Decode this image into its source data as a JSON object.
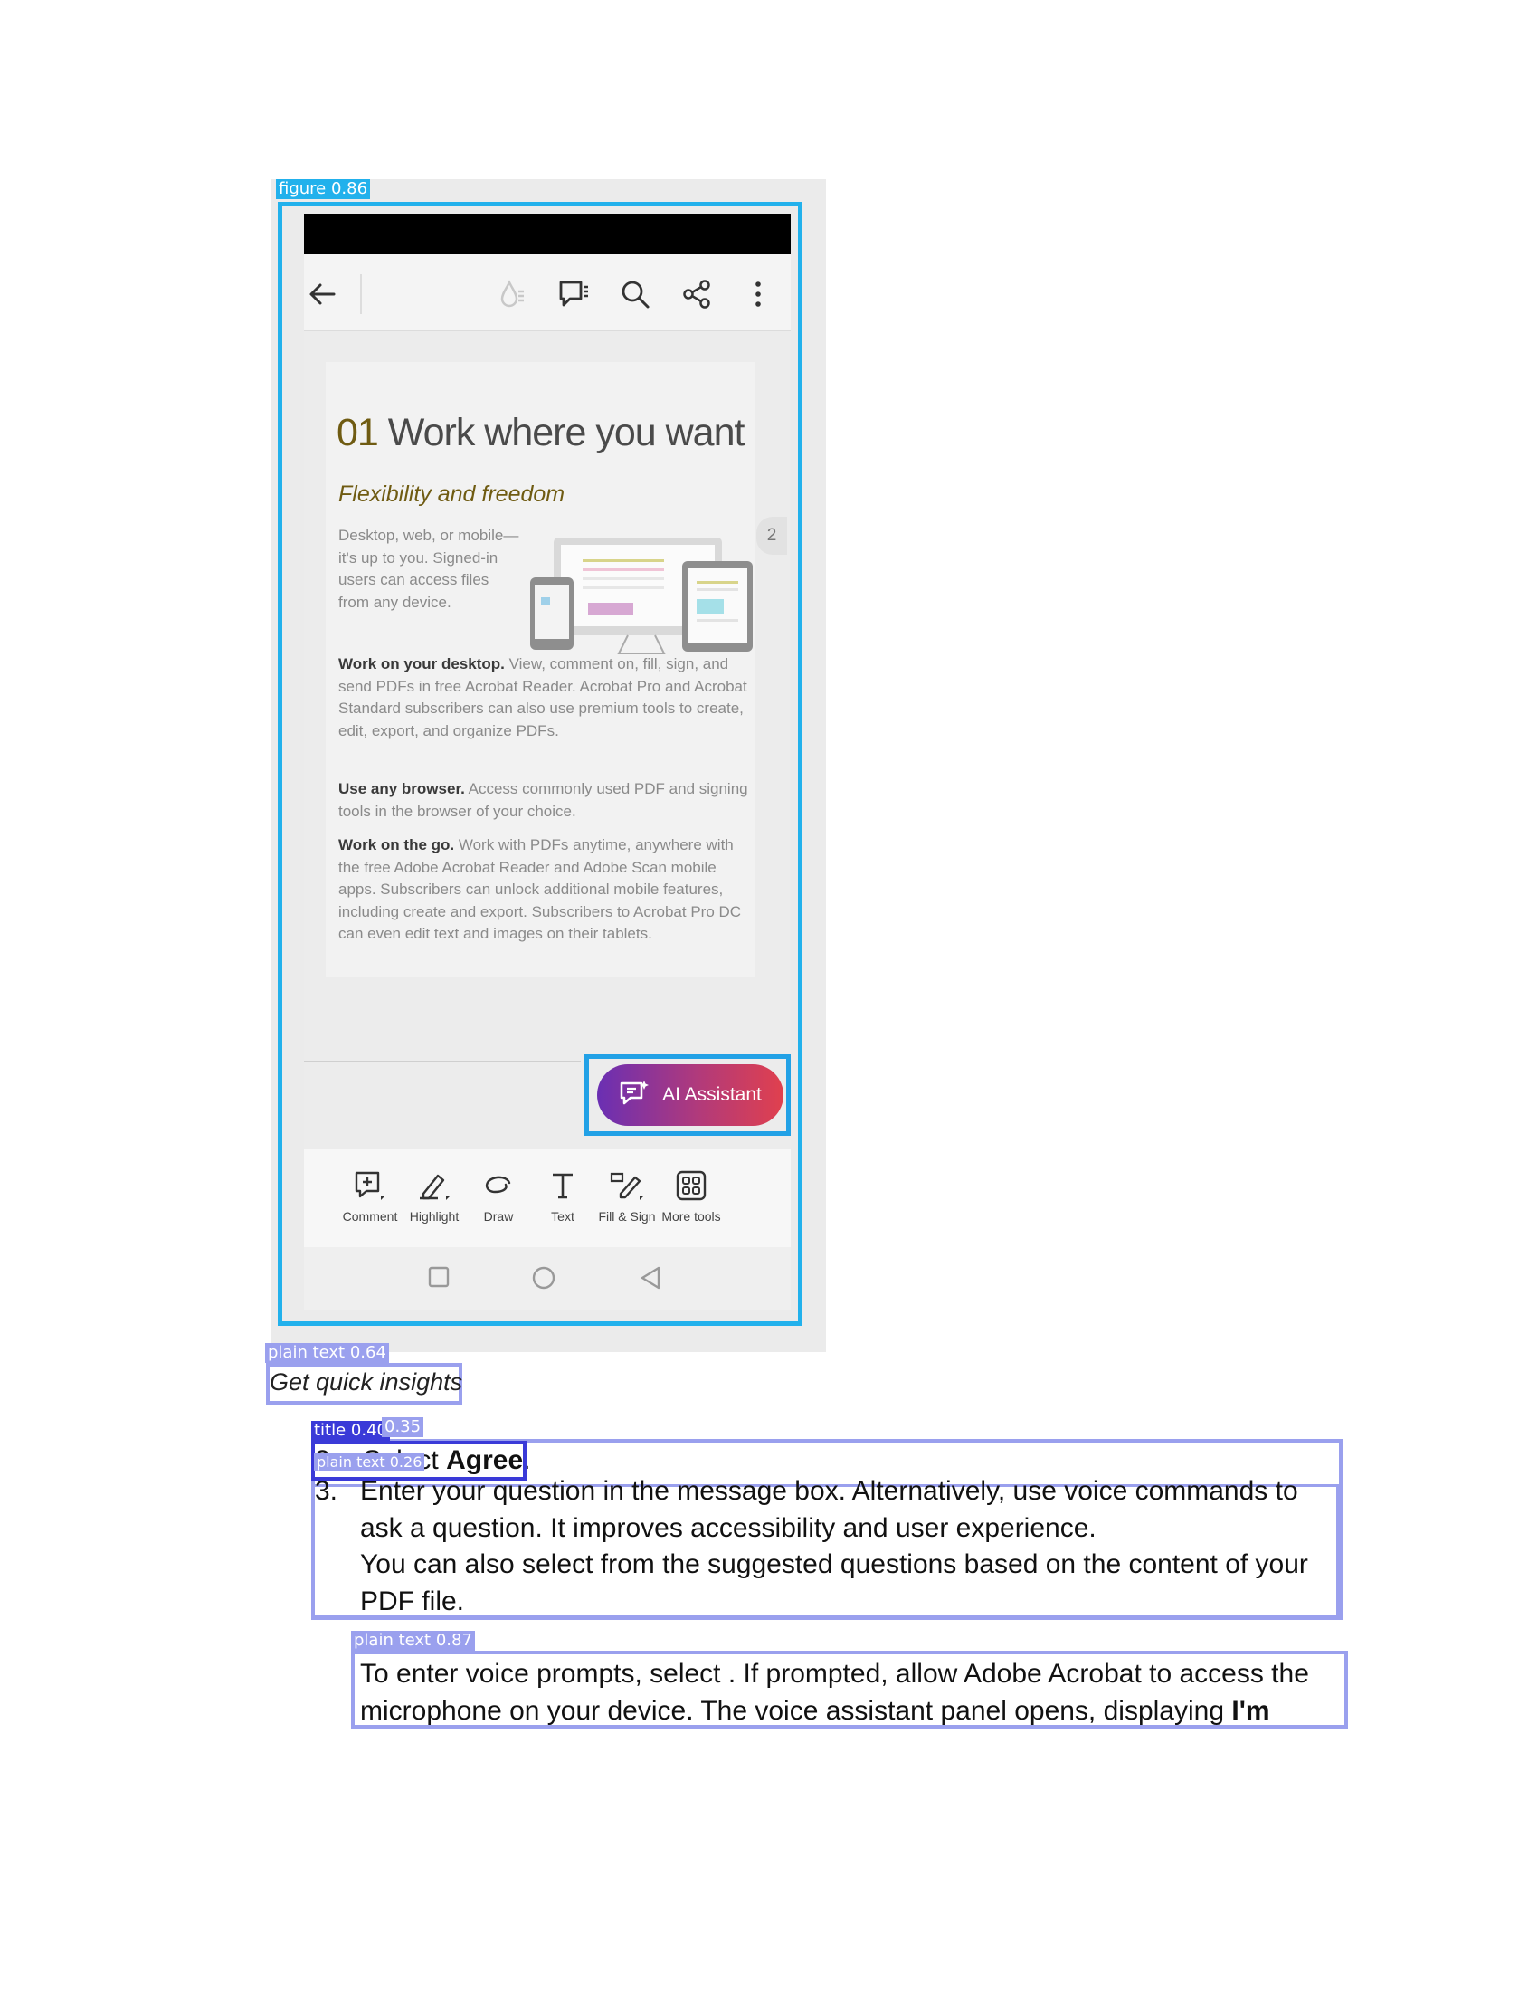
{
  "detections": {
    "figure": "figure 0.86",
    "caption": "plain text 0.64",
    "title": "title 0.40",
    "title_score_b": "0.35",
    "step_plain": "plain text 0.26",
    "note": "plain text 0.87"
  },
  "phone": {
    "page_heading_number": "01",
    "page_heading": "Work where you want",
    "page_subheading": "Flexibility and freedom",
    "intro_text": "Desktop, web, or mobile—it's up to you. Signed-in users can access files from any device.",
    "desktop_title": "Work on your desktop.",
    "desktop_text": "View, comment on, fill, sign, and send PDFs in free Acrobat Reader. Acrobat Pro and Acrobat Standard subscribers can also use premium tools to create, edit, export, and organize PDFs.",
    "browser_title": "Use any browser.",
    "browser_text": "Access commonly used PDF and signing tools in the browser of your choice.",
    "go_title": "Work on the go.",
    "go_text": "Work with PDFs anytime, anywhere with the free Adobe Acrobat Reader and Adobe Scan mobile apps. Subscribers can unlock additional mobile features, including create and export. Subscribers to Acrobat Pro DC can even edit text and images on their tablets.",
    "page_number": "2",
    "ai_button_label": "AI Assistant",
    "tools": [
      "Comment",
      "Highlight",
      "Draw",
      "Text",
      "Fill & Sign",
      "More tools"
    ],
    "toolbar_icons": [
      "back-arrow-icon",
      "reading-mode-icon",
      "comment-list-icon",
      "search-icon",
      "share-icon",
      "more-options-icon"
    ],
    "nav_icons": [
      "recents-square-icon",
      "home-circle-icon",
      "back-triangle-icon"
    ]
  },
  "caption": "Get quick insights",
  "step2": {
    "number": "2.",
    "prefix": "Select ",
    "bold": "Agree",
    "suffix": "."
  },
  "step3": {
    "number": "3.",
    "line1": "Enter your question in the message box. Alternatively, use voice commands to ask a question. It improves accessibility and user experience.",
    "line2": "You can also select from the suggested questions based on the content of your PDF file."
  },
  "note": {
    "text": "To enter voice prompts, select  . If prompted, allow Adobe Acrobat to access the microphone on your device. The voice assistant panel opens, displaying ",
    "bold": "I'm"
  },
  "colors": {
    "figure_border": "#22b1ec",
    "detection_box": "#9aa0ee",
    "title_box": "#3a3ad8",
    "ai_gradient_start": "#6a2fb3",
    "ai_gradient_end": "#e0404e",
    "heading_accent": "#6f5b12"
  }
}
